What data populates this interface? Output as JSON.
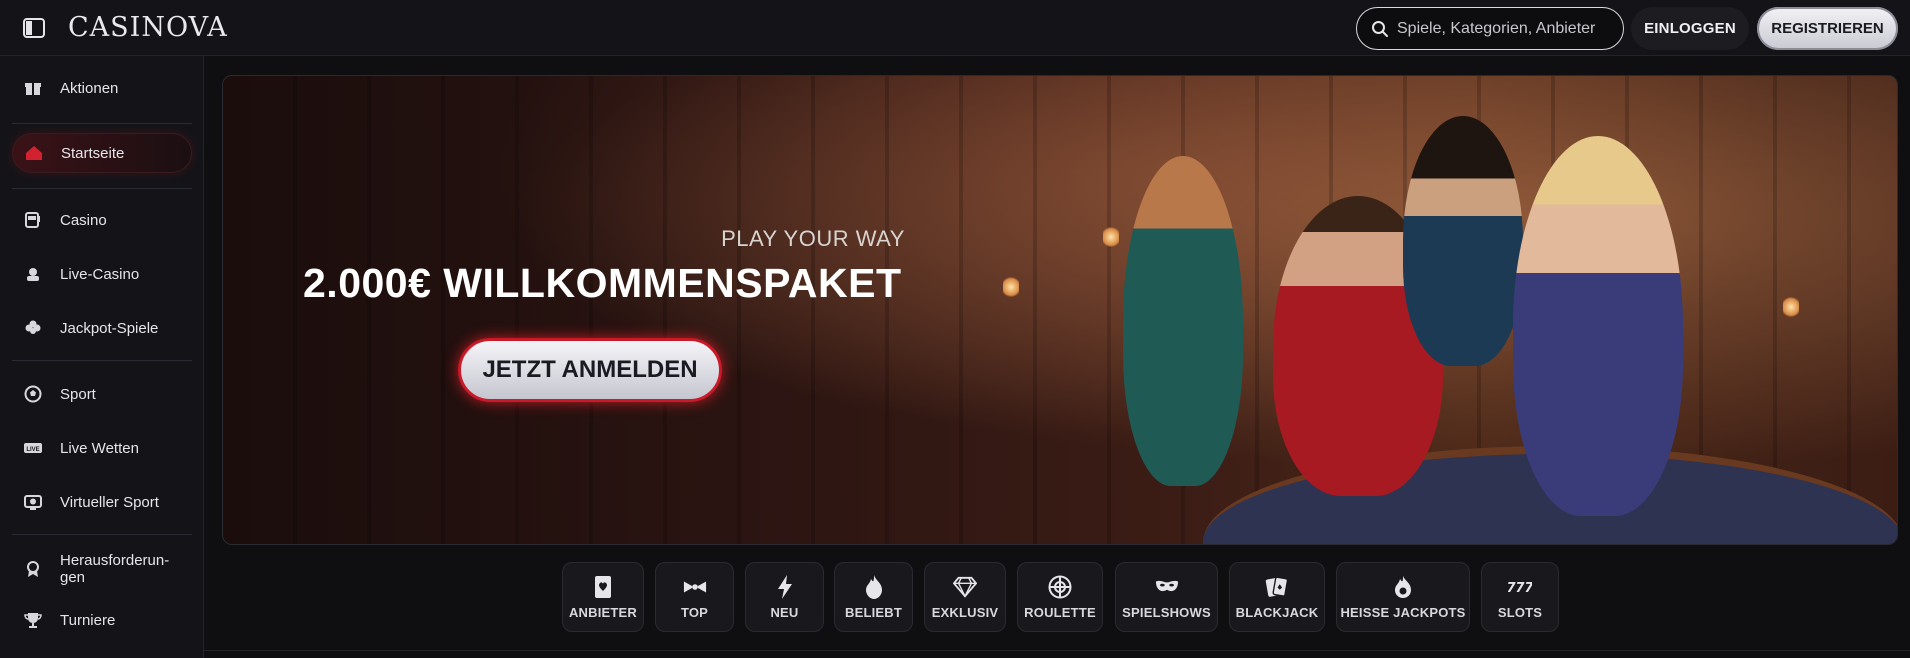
{
  "header": {
    "logo": "CASINOVA",
    "search_placeholder": "Spiele, Kategorien, Anbieter",
    "login_label": "EINLOGGEN",
    "register_label": "REGISTRIEREN"
  },
  "sidebar": {
    "items": [
      {
        "label": "Aktionen",
        "icon": "gift-icon"
      },
      {
        "label": "Startseite",
        "icon": "home-icon",
        "active": true
      },
      {
        "label": "Casino",
        "icon": "slot-machine-icon"
      },
      {
        "label": "Live-Casino",
        "icon": "dealer-icon"
      },
      {
        "label": "Jackpot-Spiele",
        "icon": "clover-icon"
      },
      {
        "label": "Sport",
        "icon": "soccer-ball-icon"
      },
      {
        "label": "Live Wetten",
        "icon": "live-icon"
      },
      {
        "label": "Virtueller Sport",
        "icon": "virtual-sport-icon"
      },
      {
        "label": "Herausforderun-\ngen",
        "icon": "medal-icon"
      },
      {
        "label": "Turniere",
        "icon": "trophy-icon"
      }
    ]
  },
  "banner": {
    "subheadline": "PLAY YOUR WAY",
    "headline": "2.000€ WILLKOMMENSPAKET",
    "cta_label": "JETZT ANMELDEN"
  },
  "categories": [
    {
      "label": "ANBIETER",
      "icon": "provider-card-icon"
    },
    {
      "label": "TOP",
      "icon": "bowtie-icon"
    },
    {
      "label": "NEU",
      "icon": "lightning-icon"
    },
    {
      "label": "BELIEBT",
      "icon": "flame-icon"
    },
    {
      "label": "EXKLUSIV",
      "icon": "diamond-icon"
    },
    {
      "label": "ROULETTE",
      "icon": "roulette-icon"
    },
    {
      "label": "SPIELSHOWS",
      "icon": "mask-icon"
    },
    {
      "label": "BLACKJACK",
      "icon": "cards-icon"
    },
    {
      "label": "HEISSE JACKPOTS",
      "icon": "hot-jackpot-icon"
    },
    {
      "label": "SLOTS",
      "icon": "777-icon"
    }
  ],
  "colors": {
    "background": "#0f0f12",
    "accent_red": "#c81a28",
    "button_light": "#e6e6ec"
  }
}
